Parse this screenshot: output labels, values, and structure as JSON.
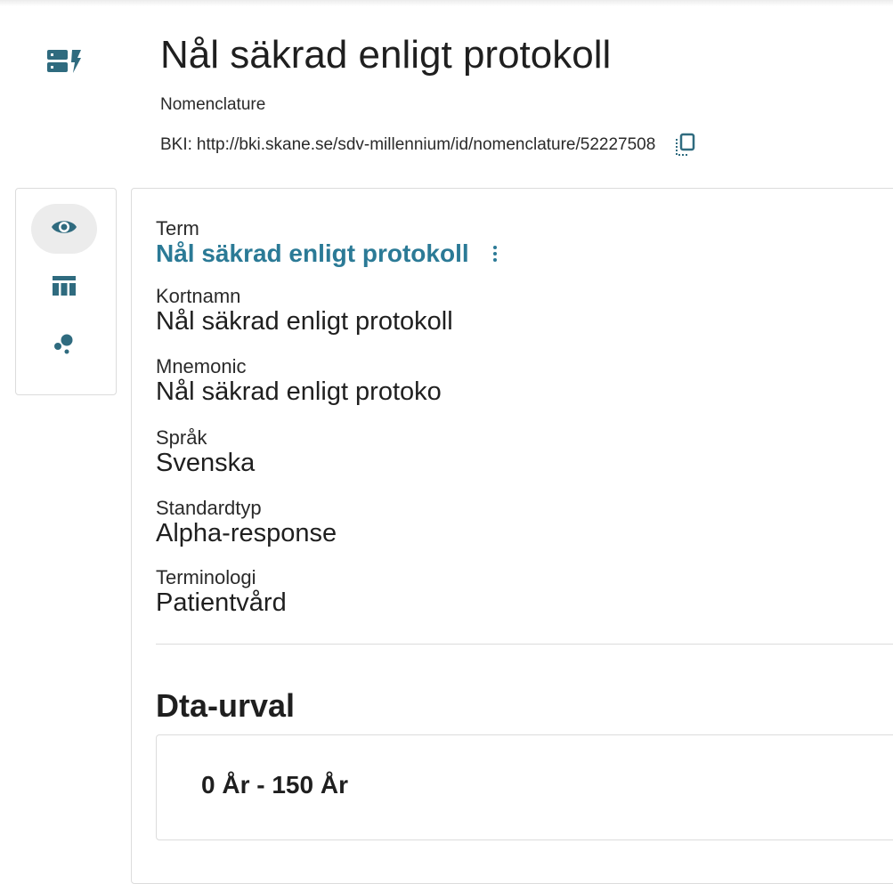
{
  "header": {
    "icon": "dynamic-form-icon",
    "title": "Nål säkrad enligt protokoll",
    "type_label": "Nomenclature",
    "bki_label": "BKI:",
    "bki_url": "http://bki.skane.se/sdv-millennium/id/nomenclature/52227508",
    "copy_icon": "copy-icon"
  },
  "sidebar": {
    "items": [
      {
        "icon": "eye-icon",
        "active": true
      },
      {
        "icon": "table-columns-icon",
        "active": false
      },
      {
        "icon": "bubble-chart-icon",
        "active": false
      }
    ]
  },
  "details": {
    "term_label": "Term",
    "term_value": "Nål säkrad enligt protokoll",
    "kortnamn_label": "Kortnamn",
    "kortnamn_value": "Nål säkrad enligt protokoll",
    "mnemonic_label": "Mnemonic",
    "mnemonic_value": "Nål säkrad enligt protoko",
    "sprak_label": "Språk",
    "sprak_value": "Svenska",
    "standardtyp_label": "Standardtyp",
    "standardtyp_value": "Alpha-response",
    "terminologi_label": "Terminologi",
    "terminologi_value": "Patientvård"
  },
  "dta": {
    "title": "Dta-urval",
    "range": "0 År - 150 År"
  },
  "colors": {
    "accent": "#2b7a96",
    "icon": "#2f6b7f"
  }
}
